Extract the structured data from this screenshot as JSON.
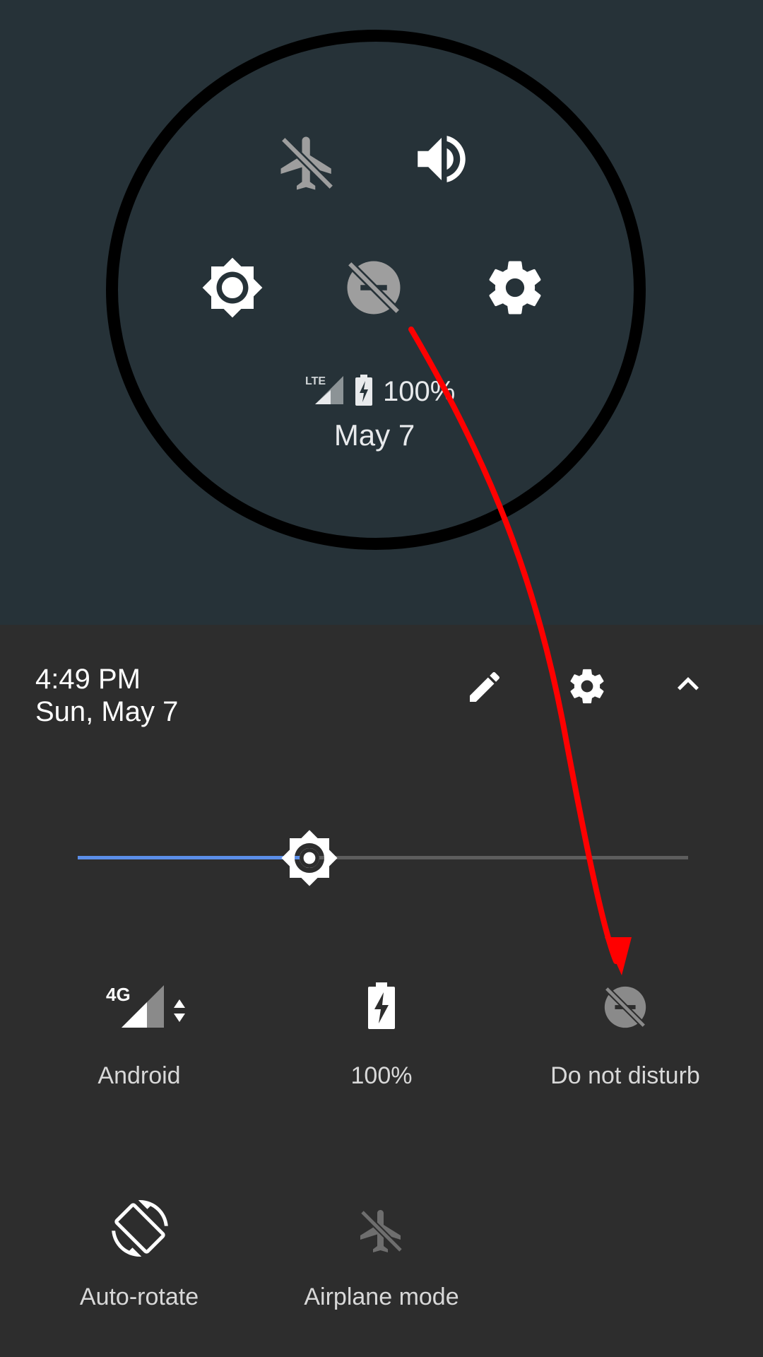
{
  "zoom": {
    "battery_percent": "100%",
    "date": "May 7",
    "network_label": "LTE"
  },
  "header": {
    "time": "4:49 PM",
    "date": "Sun, May 7"
  },
  "brightness": {
    "level": 0.38
  },
  "tiles": {
    "mobile": {
      "label": "Android",
      "network": "4G"
    },
    "battery": {
      "label": "100%"
    },
    "dnd": {
      "label": "Do not disturb"
    },
    "rotate": {
      "label": "Auto-rotate"
    },
    "airplane": {
      "label": "Airplane mode"
    }
  },
  "colors": {
    "top_background": "#263238",
    "panel_background": "#2d2d2d",
    "slider_accent": "#5b8ee8",
    "annotation_arrow": "#ff0000"
  },
  "icons": [
    "airplane-icon",
    "volume-icon",
    "brightness-icon",
    "do-not-disturb-icon",
    "settings-icon",
    "edit-icon",
    "chevron-up-icon",
    "signal-icon",
    "battery-charging-icon",
    "auto-rotate-icon"
  ]
}
